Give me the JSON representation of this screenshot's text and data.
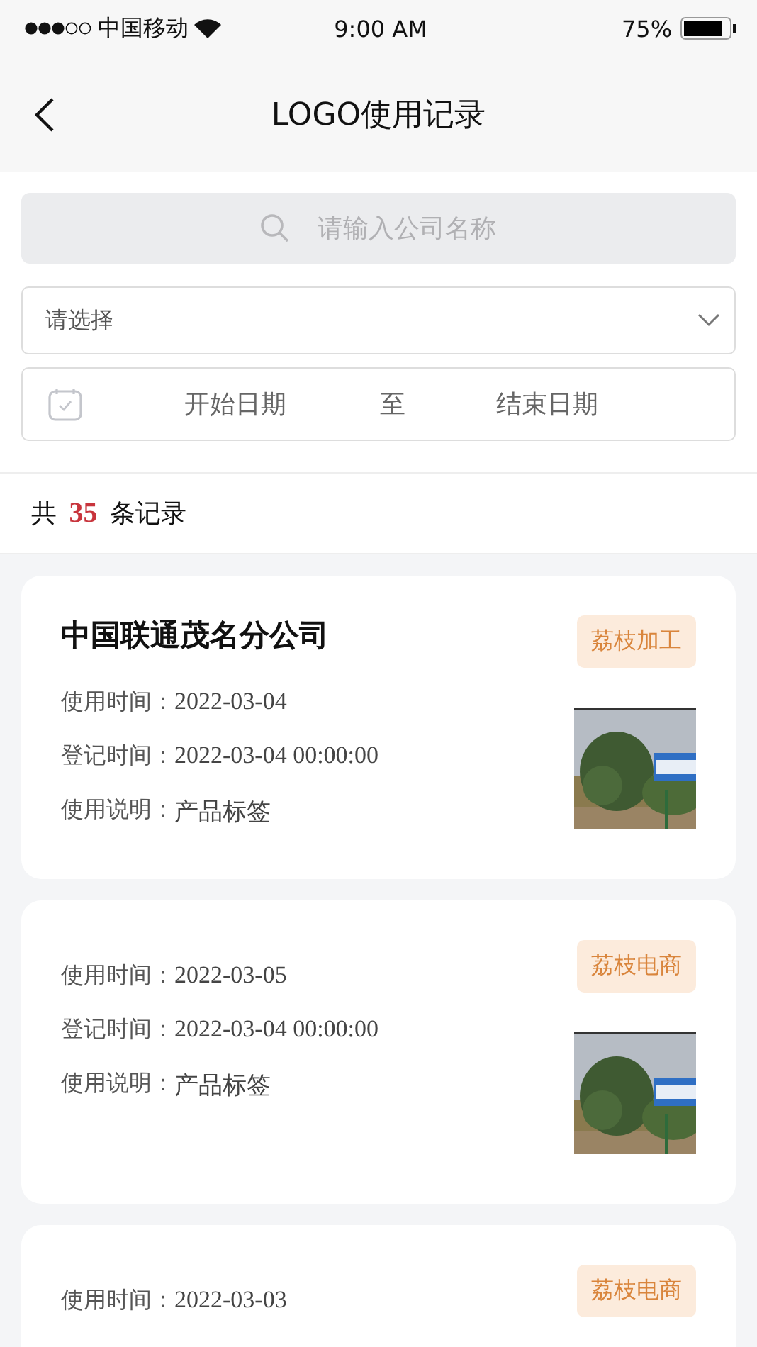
{
  "status_bar": {
    "carrier": "中国移动",
    "time": "9:00 AM",
    "battery": "75%"
  },
  "nav": {
    "title": "LOGO使用记录"
  },
  "search": {
    "placeholder": "请输入公司名称"
  },
  "select": {
    "placeholder": "请选择"
  },
  "date_range": {
    "start_placeholder": "开始日期",
    "separator": "至",
    "end_placeholder": "结束日期"
  },
  "summary": {
    "text": "共 **35** 条记录"
  },
  "records": [
    {
      "company": "中国联通茂名分公司",
      "tag": "荔枝加工",
      "fields": [
        {
          "label": "使用时间：",
          "value": "2022-03-04"
        },
        {
          "label": "登记时间：",
          "value": "2022-03-04 00:00:00"
        },
        {
          "label": "使用说明：",
          "value": "产品标签"
        }
      ]
    },
    {
      "tag": "荔枝电商",
      "fields": [
        {
          "label": "使用时间：",
          "value": "2022-03-05"
        },
        {
          "label": "登记时间：",
          "value": "2022-03-04 00:00:00"
        },
        {
          "label": "使用说明：",
          "value": "产品标签"
        }
      ]
    },
    {
      "tag": "荔枝电商",
      "fields": [
        {
          "label": "使用时间：",
          "value": "2022-03-03"
        }
      ]
    }
  ]
}
